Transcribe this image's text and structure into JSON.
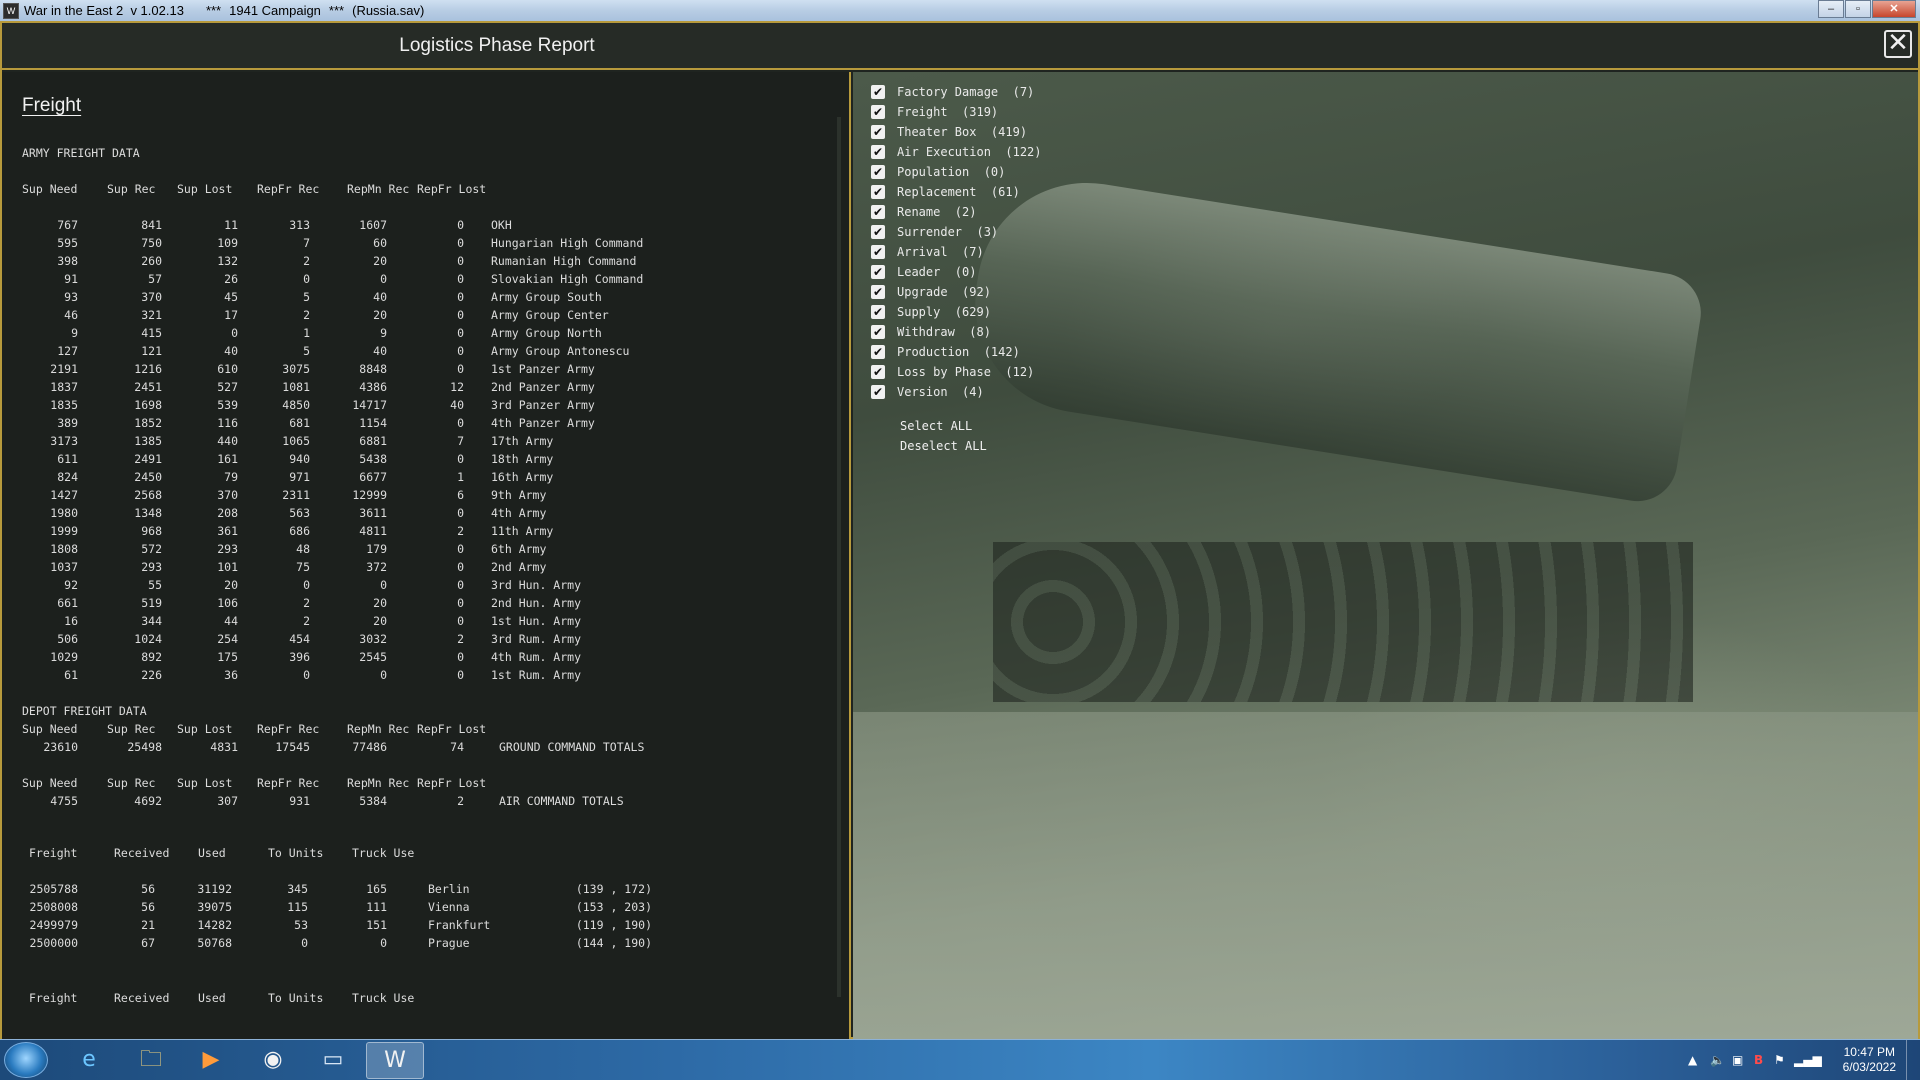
{
  "window": {
    "title_app": "War in the East 2  v 1.02.13",
    "title_sep1": "***",
    "title_campaign": "1941 Campaign",
    "title_sep2": "***",
    "title_file": "(Russia.sav)"
  },
  "report": {
    "title": "Logistics Phase Report",
    "section_title": "Freight",
    "army_heading": "ARMY FREIGHT DATA",
    "army_columns": [
      "Sup Need",
      "Sup Rec",
      "Sup Lost",
      "RepFr Rec",
      "RepMn Rec",
      "RepFr Lost"
    ],
    "army_rows": [
      [
        "767",
        "841",
        "11",
        "313",
        "1607",
        "0",
        "OKH"
      ],
      [
        "595",
        "750",
        "109",
        "7",
        "60",
        "0",
        "Hungarian High Command"
      ],
      [
        "398",
        "260",
        "132",
        "2",
        "20",
        "0",
        "Rumanian High Command"
      ],
      [
        "91",
        "57",
        "26",
        "0",
        "0",
        "0",
        "Slovakian High Command"
      ],
      [
        "93",
        "370",
        "45",
        "5",
        "40",
        "0",
        "Army Group South"
      ],
      [
        "46",
        "321",
        "17",
        "2",
        "20",
        "0",
        "Army Group Center"
      ],
      [
        "9",
        "415",
        "0",
        "1",
        "9",
        "0",
        "Army Group North"
      ],
      [
        "127",
        "121",
        "40",
        "5",
        "40",
        "0",
        "Army Group Antonescu"
      ],
      [
        "2191",
        "1216",
        "610",
        "3075",
        "8848",
        "0",
        "1st Panzer Army"
      ],
      [
        "1837",
        "2451",
        "527",
        "1081",
        "4386",
        "12",
        "2nd Panzer Army"
      ],
      [
        "1835",
        "1698",
        "539",
        "4850",
        "14717",
        "40",
        "3rd Panzer Army"
      ],
      [
        "389",
        "1852",
        "116",
        "681",
        "1154",
        "0",
        "4th Panzer Army"
      ],
      [
        "3173",
        "1385",
        "440",
        "1065",
        "6881",
        "7",
        "17th Army"
      ],
      [
        "611",
        "2491",
        "161",
        "940",
        "5438",
        "0",
        "18th Army"
      ],
      [
        "824",
        "2450",
        "79",
        "971",
        "6677",
        "1",
        "16th Army"
      ],
      [
        "1427",
        "2568",
        "370",
        "2311",
        "12999",
        "6",
        "9th Army"
      ],
      [
        "1980",
        "1348",
        "208",
        "563",
        "3611",
        "0",
        "4th Army"
      ],
      [
        "1999",
        "968",
        "361",
        "686",
        "4811",
        "2",
        "11th Army"
      ],
      [
        "1808",
        "572",
        "293",
        "48",
        "179",
        "0",
        "6th Army"
      ],
      [
        "1037",
        "293",
        "101",
        "75",
        "372",
        "0",
        "2nd Army"
      ],
      [
        "92",
        "55",
        "20",
        "0",
        "0",
        "0",
        "3rd Hun. Army"
      ],
      [
        "661",
        "519",
        "106",
        "2",
        "20",
        "0",
        "2nd Hun. Army"
      ],
      [
        "16",
        "344",
        "44",
        "2",
        "20",
        "0",
        "1st Hun. Army"
      ],
      [
        "506",
        "1024",
        "254",
        "454",
        "3032",
        "2",
        "3rd Rum. Army"
      ],
      [
        "1029",
        "892",
        "175",
        "396",
        "2545",
        "0",
        "4th Rum. Army"
      ],
      [
        "61",
        "226",
        "36",
        "0",
        "0",
        "0",
        "1st Rum. Army"
      ]
    ],
    "ground_totals": {
      "columns": [
        "Sup Need",
        "Sup Rec",
        "Sup Lost",
        "RepFr Rec",
        "RepMn Rec",
        "RepFr Lost"
      ],
      "values": [
        "23610",
        "25498",
        "4831",
        "17545",
        "77486",
        "74"
      ],
      "label": "GROUND COMMAND TOTALS"
    },
    "air_totals": {
      "columns": [
        "Sup Need",
        "Sup Rec",
        "Sup Lost",
        "RepFr Rec",
        "RepMn Rec",
        "RepFr Lost"
      ],
      "values": [
        "4755",
        "4692",
        "307",
        "931",
        "5384",
        "2"
      ],
      "label": "AIR COMMAND TOTALS"
    },
    "depot_heading": "DEPOT FREIGHT DATA",
    "depot_columns": [
      "Freight",
      "Received",
      "Used",
      "To Units",
      "Truck Use"
    ],
    "depot_rows": [
      [
        "2505788",
        "56",
        "31192",
        "345",
        "165",
        "Berlin",
        "(139 , 172)"
      ],
      [
        "2508008",
        "56",
        "39075",
        "115",
        "111",
        "Vienna",
        "(153 , 203)"
      ],
      [
        "2499979",
        "21",
        "14282",
        "53",
        "151",
        "Frankfurt",
        "(119 , 190)"
      ],
      [
        "2500000",
        "67",
        "50768",
        "0",
        "0",
        "Prague",
        "(144 , 190)"
      ]
    ],
    "depot_columns_footer": [
      "Freight",
      "Received",
      "Used",
      "To Units",
      "Truck Use"
    ]
  },
  "filters": {
    "items": [
      {
        "label": "Factory Damage  (7)",
        "checked": true
      },
      {
        "label": "Freight  (319)",
        "checked": true
      },
      {
        "label": "Theater Box  (419)",
        "checked": true
      },
      {
        "label": "Air Execution  (122)",
        "checked": true
      },
      {
        "label": "Population  (0)",
        "checked": true
      },
      {
        "label": "Replacement  (61)",
        "checked": true
      },
      {
        "label": "Rename  (2)",
        "checked": true
      },
      {
        "label": "Surrender  (3)",
        "checked": true
      },
      {
        "label": "Arrival  (7)",
        "checked": true
      },
      {
        "label": "Leader  (0)",
        "checked": true
      },
      {
        "label": "Upgrade  (92)",
        "checked": true
      },
      {
        "label": "Supply  (629)",
        "checked": true
      },
      {
        "label": "Withdraw  (8)",
        "checked": true
      },
      {
        "label": "Production  (142)",
        "checked": true
      },
      {
        "label": "Loss by Phase  (12)",
        "checked": true
      },
      {
        "label": "Version  (4)",
        "checked": true
      }
    ],
    "select_all": "Select ALL",
    "deselect_all": "Deselect ALL"
  },
  "taskbar": {
    "apps": [
      {
        "icon": "internet-explorer-icon",
        "glyph": "e"
      },
      {
        "icon": "file-explorer-icon",
        "glyph": "🗀"
      },
      {
        "icon": "media-player-icon",
        "glyph": "▶"
      },
      {
        "icon": "chrome-icon",
        "glyph": "◉"
      },
      {
        "icon": "window-app-icon",
        "glyph": "▭"
      },
      {
        "icon": "wite2-game-icon",
        "glyph": "W"
      }
    ],
    "clock_time": "10:47 PM",
    "clock_date": "6/03/2022"
  }
}
